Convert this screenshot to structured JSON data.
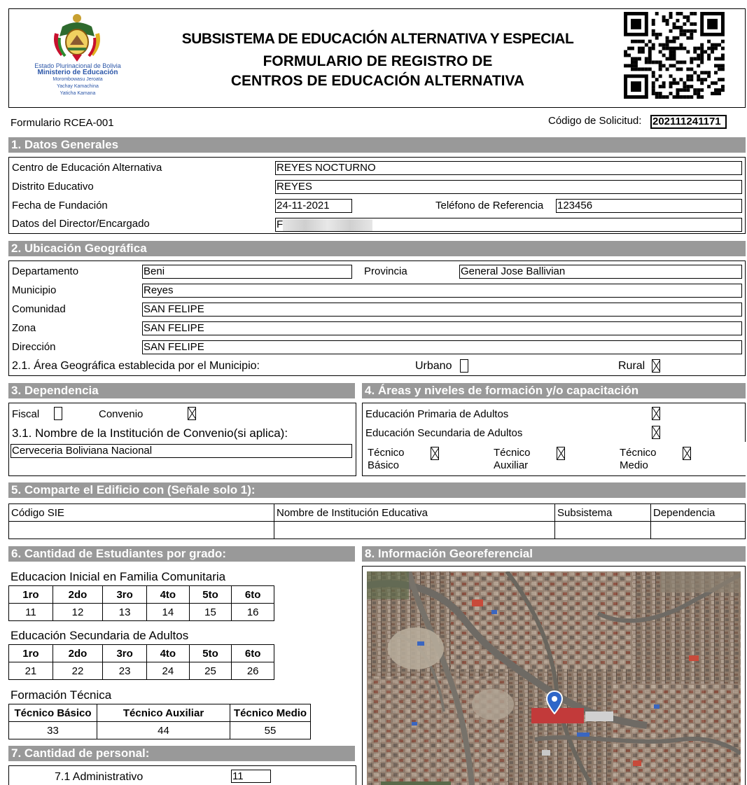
{
  "header": {
    "logo_lines": [
      "Estado Plurinacional de Bolivia",
      "Ministerio de Educación",
      "Morombowasu Jeroata",
      "Yachay Kamachina",
      "Yaticha Kamana"
    ],
    "title_1": "SUBSISTEMA DE EDUCACIÓN ALTERNATIVA Y ESPECIAL",
    "title_2": "FORMULARIO DE REGISTRO DE",
    "title_3": "CENTROS DE EDUCACIÓN ALTERNATIVA",
    "qr_icon": "qr-code-icon"
  },
  "form_id": "Formulario RCEA-001",
  "solicitud": {
    "label": "Código de Solicitud:",
    "value": "202111241171"
  },
  "section1": {
    "title": "1. Datos Generales",
    "centro_label": "Centro de Educación Alternativa",
    "centro_value": "REYES NOCTURNO",
    "distrito_label": "Distrito Educativo",
    "distrito_value": "REYES",
    "fecha_label": "Fecha de Fundación",
    "fecha_value": "24-11-2021",
    "telefono_label": "Teléfono de Referencia",
    "telefono_value": "123456",
    "director_label": "Datos del Director/Encargado",
    "director_value": "FF"
  },
  "section2": {
    "title": "2. Ubicación Geográfica",
    "departamento_label": "Departamento",
    "departamento_value": "Beni",
    "provincia_label": "Provincia",
    "provincia_value": "General Jose Ballivian",
    "municipio_label": "Municipio",
    "municipio_value": "Reyes",
    "comunidad_label": "Comunidad",
    "comunidad_value": "SAN FELIPE",
    "zona_label": "Zona",
    "zona_value": "SAN FELIPE",
    "direccion_label": "Dirección",
    "direccion_value": "SAN FELIPE",
    "area_label": "2.1. Área Geográfica establecida por el Municipio:",
    "urbano_label": "Urbano",
    "urbano_checked": false,
    "rural_label": "Rural",
    "rural_checked": true
  },
  "section3": {
    "title": "3. Dependencia",
    "fiscal_label": "Fiscal",
    "fiscal_checked": false,
    "convenio_label": "Convenio",
    "convenio_checked": true,
    "institucion_label": "3.1. Nombre de la Institución de Convenio(si aplica):",
    "institucion_value": "Cerveceria Boliviana Nacional"
  },
  "section4": {
    "title": "4. Áreas y niveles de formación y/o capacitación",
    "primaria_label": "Educación Primaria de Adultos",
    "primaria_checked": true,
    "secundaria_label": "Educación Secundaria de Adultos",
    "secundaria_checked": true,
    "basico_label_1": "Técnico",
    "basico_label_2": "Básico",
    "basico_checked": true,
    "auxiliar_label_1": "Técnico",
    "auxiliar_label_2": "Auxiliar",
    "auxiliar_checked": true,
    "medio_label_1": "Técnico",
    "medio_label_2": "Medio",
    "medio_checked": true
  },
  "section5": {
    "title": "5. Comparte el Edificio con (Señale solo 1):",
    "columns": [
      "Código SIE",
      "Nombre de Institución Educativa",
      "Subsistema",
      "Dependencia"
    ],
    "rows": [
      [
        "",
        "",
        "",
        ""
      ]
    ]
  },
  "section6": {
    "title": "6. Cantidad de Estudiantes por grado:",
    "inicial_label": "Educacion Inicial en Familia Comunitaria",
    "inicial_headers": [
      "1ro",
      "2do",
      "3ro",
      "4to",
      "5to",
      "6to"
    ],
    "inicial_values": [
      "11",
      "12",
      "13",
      "14",
      "15",
      "16"
    ],
    "secundaria_label": "Educación Secundaria de Adultos",
    "secundaria_headers": [
      "1ro",
      "2do",
      "3ro",
      "4to",
      "5to",
      "6to"
    ],
    "secundaria_values": [
      "21",
      "22",
      "23",
      "24",
      "25",
      "26"
    ],
    "tecnica_label": "Formación Técnica",
    "tecnica_headers": [
      "Técnico Básico",
      "Técnico Auxiliar",
      "Técnico Medio"
    ],
    "tecnica_values": [
      "33",
      "44",
      "55"
    ]
  },
  "section7": {
    "title": "7. Cantidad de personal:",
    "administrativo_label": "7.1 Administrativo",
    "administrativo_value": "11"
  },
  "section8": {
    "title": "8. Información Georeferencial",
    "marker_icon": "map-pin-icon"
  },
  "colors": {
    "section_bar": "#999999",
    "marker": "#2f66c8"
  }
}
